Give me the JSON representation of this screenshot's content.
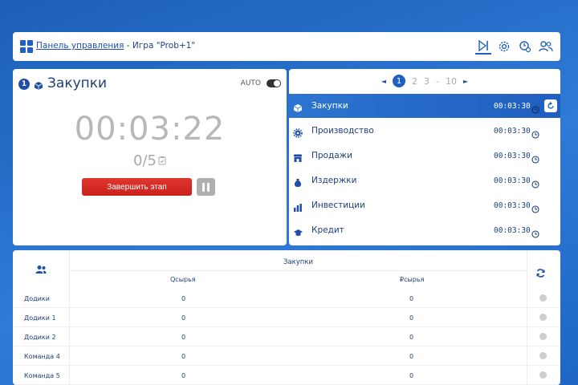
{
  "header": {
    "breadcrumb_link": "Панель управления",
    "breadcrumb_rest": " - Игра \"Prob+1\"",
    "icons": [
      "play-next-icon",
      "gear-icon",
      "stopwatch-icon",
      "users-icon"
    ]
  },
  "stage": {
    "step_number": "1",
    "title": "Закупки",
    "auto_label": "AUTO",
    "timer": "00:03:22",
    "progress": "0/5",
    "finish_label": "Завершить этап"
  },
  "pager": {
    "prev": "◄",
    "current": "1",
    "p2": "2",
    "p3": "3",
    "dash": "-",
    "last": "10",
    "next": "►"
  },
  "stages": [
    {
      "name": "Закупки",
      "time": "00:03:30",
      "icon": "cube-icon",
      "active": true
    },
    {
      "name": "Производство",
      "time": "00:03:30",
      "icon": "gear-icon",
      "active": false
    },
    {
      "name": "Продажи",
      "time": "00:03:30",
      "icon": "store-icon",
      "active": false
    },
    {
      "name": "Издержки",
      "time": "00:03:30",
      "icon": "money-bag-icon",
      "active": false
    },
    {
      "name": "Инвестиции",
      "time": "00:03:30",
      "icon": "chart-bars-icon",
      "active": false
    },
    {
      "name": "Кредит",
      "time": "00:03:30",
      "icon": "cap-icon",
      "active": false
    }
  ],
  "table": {
    "group_title": "Закупки",
    "col1": "Qсырья",
    "col2": "₽сырья",
    "rows": [
      {
        "name": "Додики",
        "q": "0",
        "p": "0"
      },
      {
        "name": "Додики 1",
        "q": "0",
        "p": "0"
      },
      {
        "name": "Додики 2",
        "q": "0",
        "p": "0"
      },
      {
        "name": "Команда 4",
        "q": "0",
        "p": "0"
      },
      {
        "name": "Команда 5",
        "q": "0",
        "p": "0"
      }
    ]
  },
  "colors": {
    "accent": "#1f5fbf",
    "danger": "#d92b26",
    "text": "#1f3f7a"
  }
}
